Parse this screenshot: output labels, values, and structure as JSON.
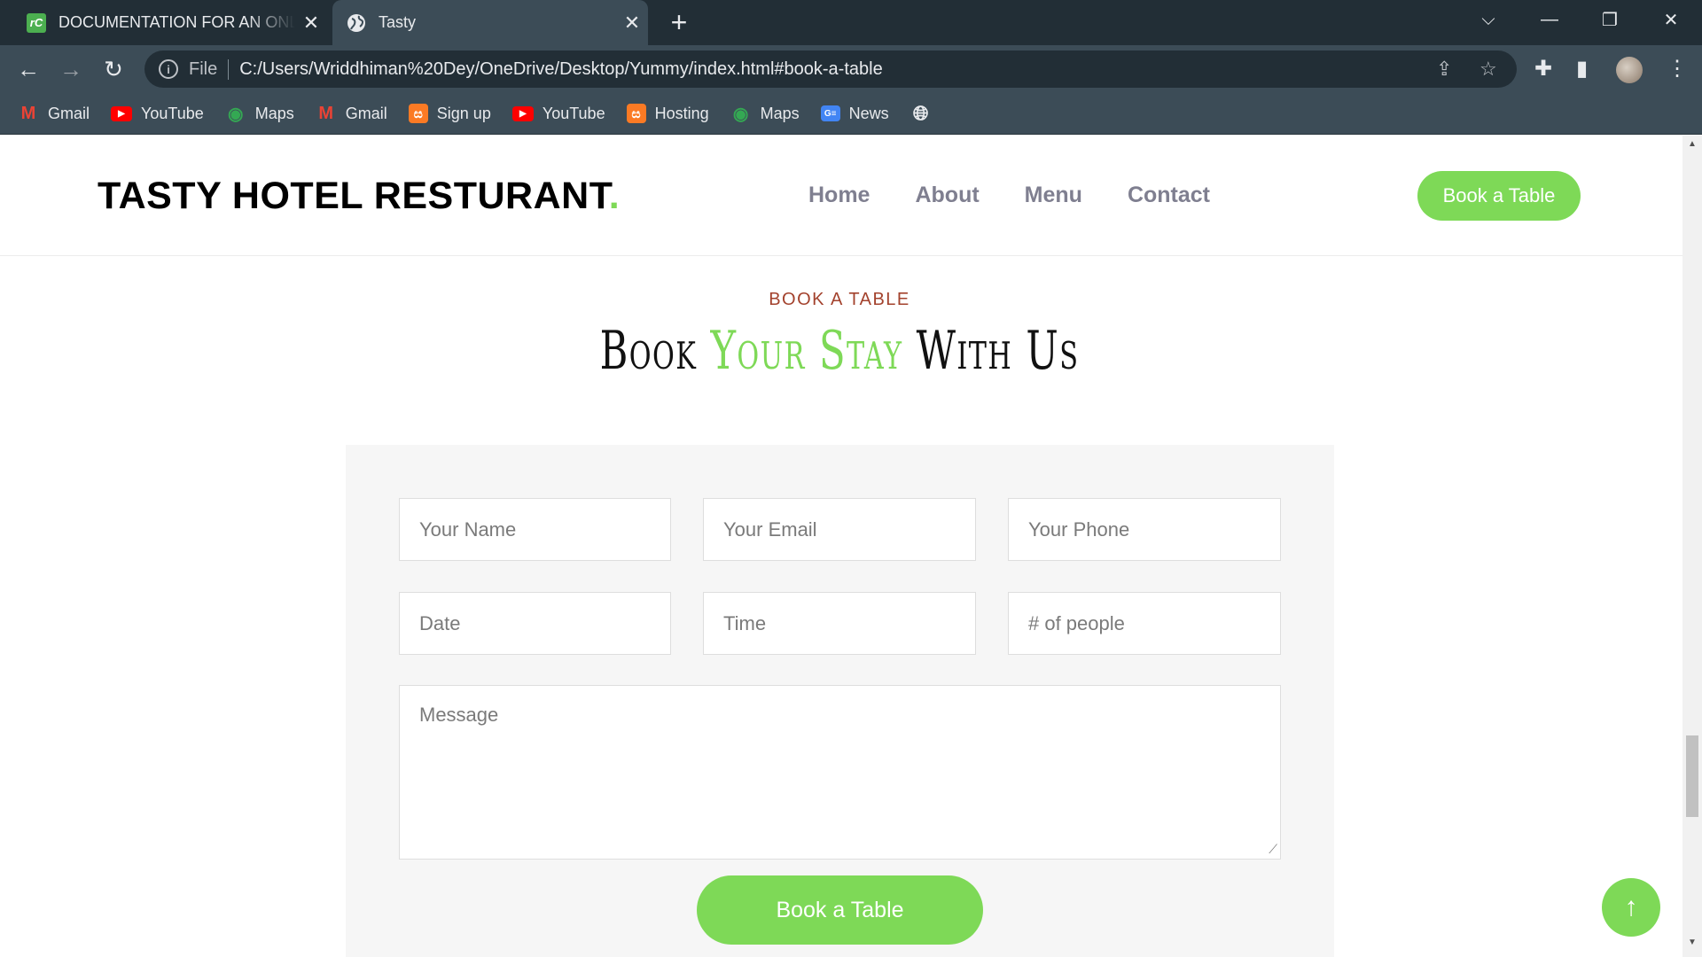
{
  "browser": {
    "tabs": [
      {
        "title": "DOCUMENTATION FOR AN ONLINE",
        "favicon": "rc",
        "active": false
      },
      {
        "title": "Tasty",
        "favicon": "globe-icon",
        "active": true
      }
    ],
    "address": {
      "scheme": "File",
      "url": "C:/Users/Wriddhiman%20Dey/OneDrive/Desktop/Yummy/index.html#book-a-table"
    },
    "bookmarks": [
      {
        "label": "Gmail",
        "icon": "gmail-icon"
      },
      {
        "label": "YouTube",
        "icon": "youtube-icon"
      },
      {
        "label": "Maps",
        "icon": "maps-icon"
      },
      {
        "label": "Gmail",
        "icon": "gmail-icon"
      },
      {
        "label": "Sign up",
        "icon": "xampp-icon"
      },
      {
        "label": "YouTube",
        "icon": "youtube-icon"
      },
      {
        "label": "Hosting",
        "icon": "xampp-icon"
      },
      {
        "label": "Maps",
        "icon": "maps-icon"
      },
      {
        "label": "News",
        "icon": "news-icon"
      }
    ]
  },
  "site": {
    "logo": {
      "text": "TASTY HOTEL RESTURANT",
      "dot": "."
    },
    "nav": [
      "Home",
      "About",
      "Menu",
      "Contact"
    ],
    "header_cta": "Book a Table"
  },
  "booking": {
    "subtitle": "BOOK A TABLE",
    "title_start": "Book ",
    "title_accent": "Your Stay",
    "title_end": " With Us",
    "fields": {
      "name": "Your Name",
      "email": "Your Email",
      "phone": "Your Phone",
      "date": "Date",
      "time": "Time",
      "people": "# of people",
      "message": "Message"
    },
    "submit": "Book a Table"
  },
  "colors": {
    "accent": "#7ed957",
    "subtitle": "#a3422d",
    "chrome_dark": "#222e36",
    "chrome": "#3c4c57"
  }
}
